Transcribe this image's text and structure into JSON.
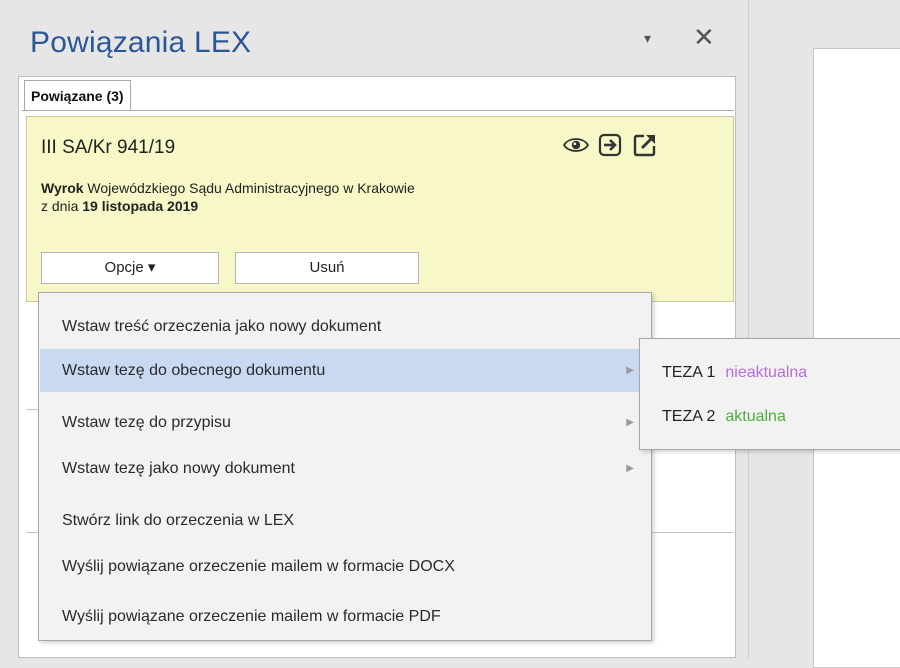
{
  "pane": {
    "title": "Powiązania LEX",
    "dropdown_glyph": "▾",
    "close_glyph": "✕"
  },
  "tabs": [
    {
      "label": "Powiązane (3)",
      "active": true
    }
  ],
  "card": {
    "code": "III SA/Kr 941/19",
    "icons": [
      "eye-icon",
      "insert-arrow-icon",
      "open-external-icon"
    ],
    "desc_bold": "Wyrok",
    "desc_rest": " Wojewódzkiego Sądu Administracyjnego w Krakowie",
    "date_prefix": "z dnia ",
    "date_bold": "19 listopada 2019",
    "buttons": {
      "options": "Opcje ▾",
      "delete": "Usuń"
    },
    "background": "#f8f7c7"
  },
  "menu": {
    "items": [
      {
        "label": "Wstaw treść orzeczenia jako nowy dokument",
        "submenu": false,
        "active": false
      },
      {
        "label": "Wstaw tezę do obecnego dokumentu",
        "submenu": true,
        "active": true
      },
      {
        "label": "Wstaw tezę do przypisu",
        "submenu": true,
        "active": false
      },
      {
        "label": "Wstaw tezę jako nowy dokument",
        "submenu": true,
        "active": false
      },
      {
        "label": "Stwórz link do orzeczenia w LEX",
        "submenu": false,
        "active": false
      },
      {
        "label": "Wyślij powiązane orzeczenie mailem w formacie DOCX",
        "submenu": false,
        "active": false
      },
      {
        "label": "Wyślij powiązane orzeczenie mailem w formacie PDF",
        "submenu": false,
        "active": false
      }
    ],
    "submenu_arrow": "▶",
    "highlight_color": "#c9d9f1"
  },
  "submenu": {
    "items": [
      {
        "label": "TEZA 1",
        "status": "nieaktualna",
        "status_color": "#b46fd8"
      },
      {
        "label": "TEZA 2",
        "status": "aktualna",
        "status_color": "#4cae3b"
      }
    ]
  },
  "colors": {
    "title": "#2b5797",
    "card_bg": "#f8f7c7"
  }
}
